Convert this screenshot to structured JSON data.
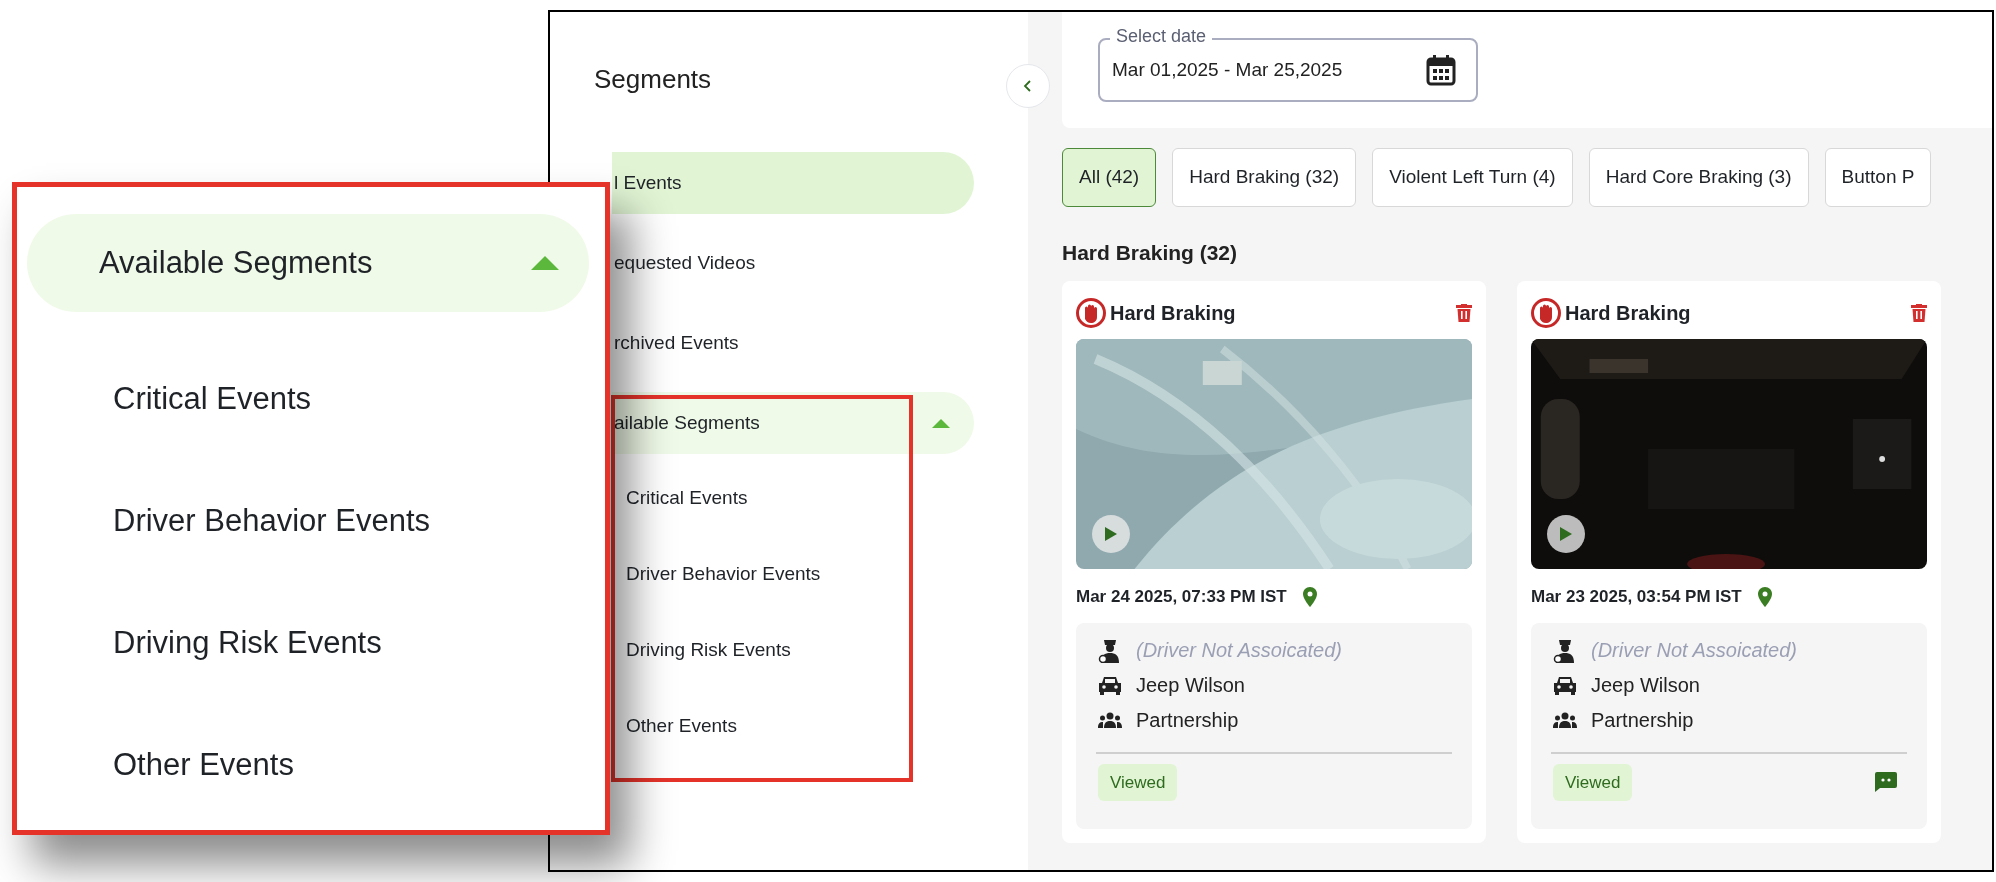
{
  "sidebar": {
    "title": "Segments",
    "items": [
      {
        "label": "l Events",
        "selected": true
      },
      {
        "label": "equested Videos",
        "selected": false
      },
      {
        "label": "rchived Events",
        "selected": false
      },
      {
        "label": "ailable Segments",
        "kind": "group",
        "expanded": true,
        "children": [
          {
            "label": "Critical Events"
          },
          {
            "label": "Driver Behavior Events"
          },
          {
            "label": "Driving Risk Events"
          },
          {
            "label": "Other Events"
          }
        ]
      }
    ]
  },
  "date_picker": {
    "label": "Select date",
    "value": "Mar 01,2025 - Mar 25,2025"
  },
  "filters": [
    {
      "label": "All (42)",
      "selected": true
    },
    {
      "label": "Hard Braking (32)",
      "selected": false
    },
    {
      "label": "Violent Left Turn (4)",
      "selected": false
    },
    {
      "label": "Hard Core Braking (3)",
      "selected": false
    },
    {
      "label": "Button P",
      "selected": false
    }
  ],
  "section_title": "Hard Braking (32)",
  "cards": [
    {
      "title": "Hard Braking",
      "date": "Mar 24 2025, 07:33 PM IST",
      "driver": "(Driver Not Assoicated)",
      "vehicle": "Jeep Wilson",
      "group": "Partnership",
      "status": "Viewed",
      "comment": false
    },
    {
      "title": "Hard Braking",
      "date": "Mar 23 2025, 03:54 PM IST",
      "driver": "(Driver Not Assoicated)",
      "vehicle": "Jeep Wilson",
      "group": "Partnership",
      "status": "Viewed",
      "comment": true
    }
  ],
  "callout": {
    "title": "Available Segments",
    "expanded": true,
    "items": [
      {
        "label": "Critical Events"
      },
      {
        "label": "Driver Behavior Events"
      },
      {
        "label": "Driving Risk Events"
      },
      {
        "label": "Other Events"
      }
    ]
  }
}
